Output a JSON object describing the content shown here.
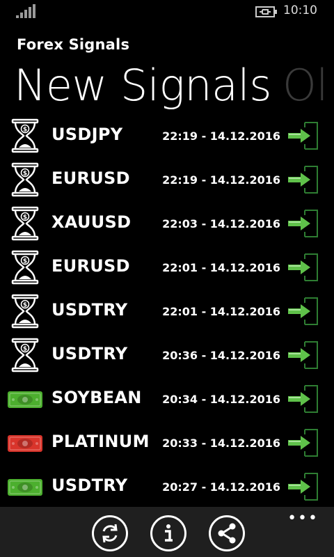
{
  "status_bar": {
    "time": "10:10"
  },
  "app": {
    "title": "Forex Signals"
  },
  "pivot": {
    "current": "New Signals",
    "next": "Ol"
  },
  "signals": [
    {
      "pair": "USDJPY",
      "time": "22:19 - 14.12.2016",
      "status": "pending"
    },
    {
      "pair": "EURUSD",
      "time": "22:19 - 14.12.2016",
      "status": "pending"
    },
    {
      "pair": "XAUUSD",
      "time": "22:03 - 14.12.2016",
      "status": "pending"
    },
    {
      "pair": "EURUSD",
      "time": "22:01 - 14.12.2016",
      "status": "pending"
    },
    {
      "pair": "USDTRY",
      "time": "22:01 - 14.12.2016",
      "status": "pending"
    },
    {
      "pair": "USDTRY",
      "time": "20:36 - 14.12.2016",
      "status": "pending"
    },
    {
      "pair": "SOYBEAN",
      "time": "20:34 - 14.12.2016",
      "status": "profit"
    },
    {
      "pair": "PLATINUM",
      "time": "20:33 - 14.12.2016",
      "status": "loss"
    },
    {
      "pair": "USDTRY",
      "time": "20:27 - 14.12.2016",
      "status": "profit"
    }
  ],
  "icons": {
    "pending": "hourglass-dollar-icon",
    "profit": "green-banknote-icon",
    "loss": "red-banknote-icon",
    "open": "enter-arrow-icon"
  },
  "colors": {
    "background": "#000000",
    "appbar": "#1f1f1f",
    "profit": "#4caf2e",
    "loss": "#d9342b",
    "arrow": "#5fc14a",
    "door": "#2e7d32"
  },
  "app_bar": {
    "buttons": [
      "refresh-icon",
      "info-icon",
      "share-icon"
    ],
    "more": "•••"
  }
}
